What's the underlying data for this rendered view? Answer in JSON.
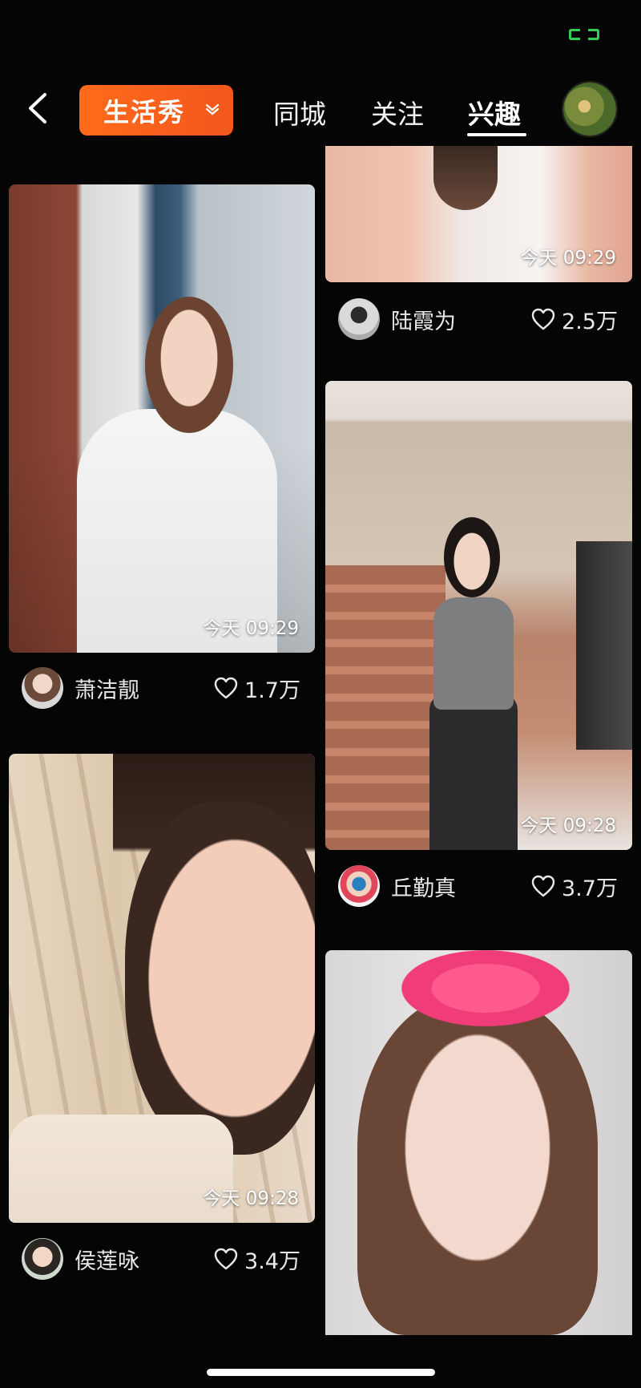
{
  "nav": {
    "category": "生活秀",
    "tabs": [
      "同城",
      "关注",
      "兴趣"
    ],
    "active_tab": "兴趣"
  },
  "cards": [
    {
      "name": "陆霞为",
      "likes": "2.5万",
      "time": "今天 09:29"
    },
    {
      "name": "萧洁靓",
      "likes": "1.7万",
      "time": "今天 09:29"
    },
    {
      "name": "丘勤真",
      "likes": "3.7万",
      "time": "今天 09:28"
    },
    {
      "name": "侯莲咏",
      "likes": "3.4万",
      "time": "今天 09:28"
    },
    {
      "name": "",
      "likes": "",
      "time": ""
    }
  ],
  "colors": {
    "accent": "#f3571d",
    "background": "#050505",
    "status_green": "#2fcf55"
  }
}
